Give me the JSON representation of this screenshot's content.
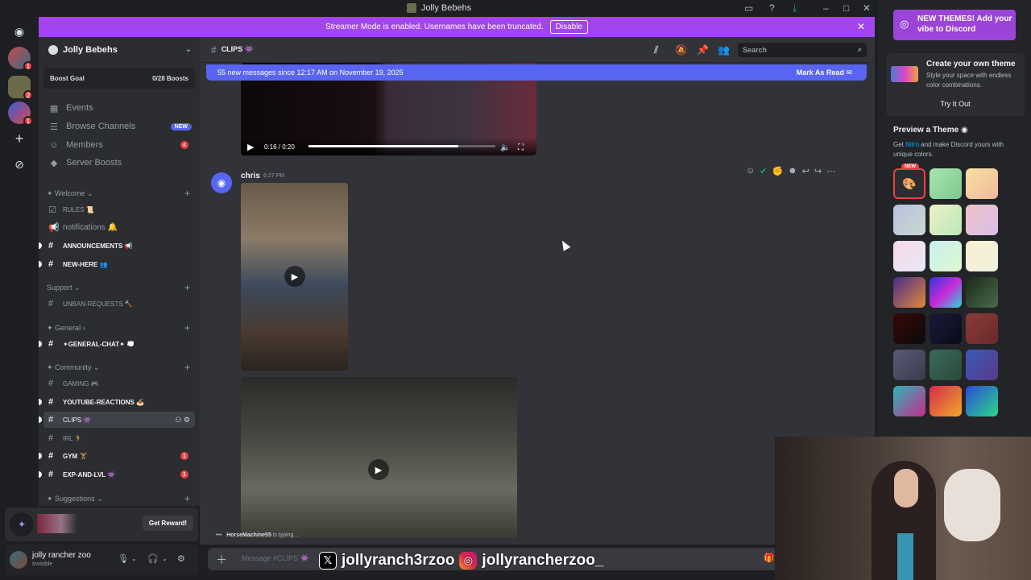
{
  "window": {
    "title": "Jolly Bebehs"
  },
  "streamer_banner": {
    "text": "Streamer Mode is enabled. Usernames have been truncated.",
    "disable_label": "Disable"
  },
  "server": {
    "name": "Jolly Bebehs",
    "boost_goal_label": "Boost Goal",
    "boost_count": "0/28 Boosts"
  },
  "rail_badges": [
    "1",
    "2",
    "1"
  ],
  "nav": [
    {
      "label": "Events",
      "icon": "calendar-icon"
    },
    {
      "label": "Browse Channels",
      "icon": "browse-icon",
      "badge": "NEW"
    },
    {
      "label": "Members",
      "icon": "members-icon",
      "count": "4"
    },
    {
      "label": "Server Boosts",
      "icon": "boost-icon"
    }
  ],
  "categories": {
    "welcome": "Welcome",
    "support": "Support",
    "general": "General",
    "community": "Community",
    "suggestions": "Suggestions"
  },
  "channels": {
    "rules": "RULES 📜",
    "notifications": "notifications 🔔",
    "announcements": "ANNOUNCEMENTS 📢",
    "new_here": "NEW-HERE 👥",
    "unban": "UNBAN-REQUESTS 🔨",
    "general_chat": "✦GENERAL-CHAT✦ 💭",
    "gaming": "GAMING 🎮",
    "youtube": "YOUTUBE-REACTIONS 🍝",
    "clips": "CLIPS 👾",
    "irl": "IRL 🏃",
    "gym": "GYM 🏋",
    "gym_count": "1",
    "exp": "EXP-AND-LVL 👾",
    "exp_count": "1"
  },
  "activity": {
    "reward_label": "Get Reward!"
  },
  "user": {
    "name": "jolly rancher zoo",
    "status": "Invisible"
  },
  "chat": {
    "channel": "CLIPS 👾",
    "search_placeholder": "Search",
    "new_messages": "55 new messages since 12:17 AM on November 19, 2025",
    "mark_read": "Mark As Read",
    "video_time": "0:16 / 0:20",
    "message": {
      "author": "chris",
      "time": "6:27 PM"
    },
    "typing_user": "HorseMachine55",
    "typing_suffix": " is typing...",
    "composer_placeholder": "Message #CLIPS 👾"
  },
  "overlay": {
    "x_handle": "jollyranch3rzoo",
    "ig_handle": "jollyrancherzoo_"
  },
  "themes_panel": {
    "banner": "NEW THEMES! Add your vibe to Discord",
    "create_title": "Create your own theme",
    "create_desc": "Style your space with endless color combinations.",
    "try_label": "Try It Out",
    "preview_title": "Preview a Theme",
    "preview_desc_get": "Get ",
    "preview_desc_nitro": "Nitro",
    "preview_desc_rest": " and make Discord yours with unique colors.",
    "new_tag": "NEW"
  },
  "colors": {
    "accent": "#5865f2",
    "streamer_banner": "#a245f0",
    "danger": "#f23f43"
  }
}
